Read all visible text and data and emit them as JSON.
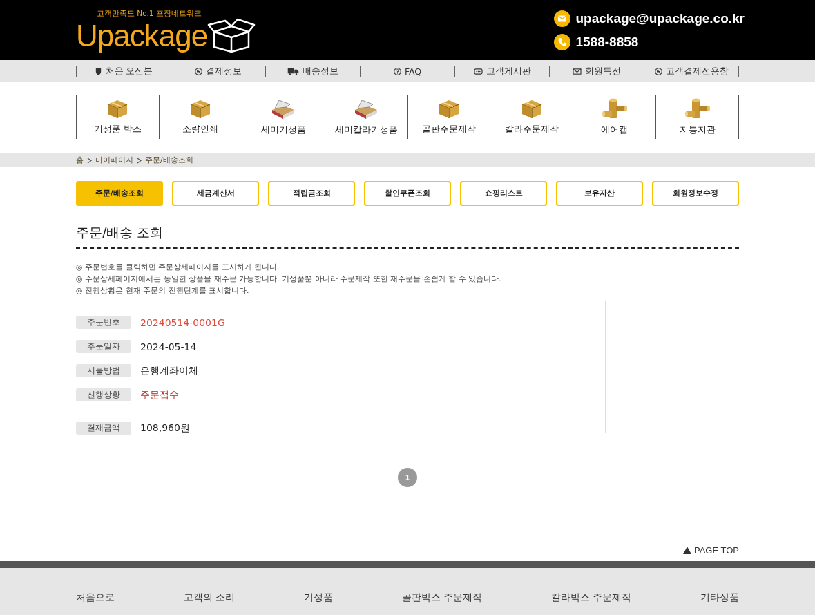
{
  "header": {
    "logo": "Upackage",
    "slogan": "고객만족도 No.1  포장네트워크",
    "email": "upackage@upackage.co.kr",
    "phone": "1588-8858"
  },
  "top_nav": [
    {
      "label": "처음 오신분",
      "kind": "shield"
    },
    {
      "label": "결제정보",
      "kind": "won"
    },
    {
      "label": "배송정보",
      "kind": "truck"
    },
    {
      "label": "FAQ",
      "kind": "help"
    },
    {
      "label": "고객게시판",
      "kind": "chat"
    },
    {
      "label": "회원특전",
      "kind": "mail"
    },
    {
      "label": "고객결제전용창",
      "kind": "won"
    }
  ],
  "categories": [
    {
      "label": "기성품 박스",
      "kind": "box"
    },
    {
      "label": "소량인쇄",
      "kind": "box"
    },
    {
      "label": "세미기성품",
      "kind": "open"
    },
    {
      "label": "세미칼라기성품",
      "kind": "open"
    },
    {
      "label": "골판주문제작",
      "kind": "box"
    },
    {
      "label": "칼라주문제작",
      "kind": "box"
    },
    {
      "label": "에어캡",
      "kind": "roll"
    },
    {
      "label": "지통지관",
      "kind": "roll"
    }
  ],
  "breadcrumb": [
    "홈",
    "마이페이지",
    "주문/배송조회"
  ],
  "tabs": [
    {
      "label": "주문/배송조회",
      "selected": true
    },
    {
      "label": "세금계산서",
      "selected": false
    },
    {
      "label": "적립금조회",
      "selected": false
    },
    {
      "label": "할인쿠폰조회",
      "selected": false
    },
    {
      "label": "쇼핑리스트",
      "selected": false
    },
    {
      "label": "보유자산",
      "selected": false
    },
    {
      "label": "회원정보수정",
      "selected": false
    }
  ],
  "page_title": "주문/배송 조회",
  "notes": [
    "주문번호를 클릭하면 주문상세페이지를 표시하게 됩니다.",
    "주문상세페이지에서는 동일한 상품을 재주문 가능합니다. 기성품뿐 아니라 주문제작 또한 재주문을 손쉽게 할 수 있습니다.",
    "진행상황은 현재 주문의 진행단계를 표시합니다."
  ],
  "note_bullet": "◎",
  "order": {
    "fields": [
      {
        "label": "주문번호",
        "value": "20240514-0001G",
        "kind": "link"
      },
      {
        "label": "주문일자",
        "value": "2024-05-14",
        "kind": "plain"
      },
      {
        "label": "지불방법",
        "value": "은행계좌이체",
        "kind": "plain"
      },
      {
        "label": "진행상황",
        "value": "주문접수",
        "kind": "status"
      }
    ],
    "total": {
      "label": "결재금액",
      "value": "108,960원"
    }
  },
  "pagination": [
    {
      "label": "1",
      "selected": true
    }
  ],
  "page_top": "PAGE TOP",
  "footer_columns": [
    "처음으로",
    "고객의 소리",
    "기성품",
    "골판박스 주문제작",
    "칼라박스 주문제작",
    "기타상품"
  ]
}
